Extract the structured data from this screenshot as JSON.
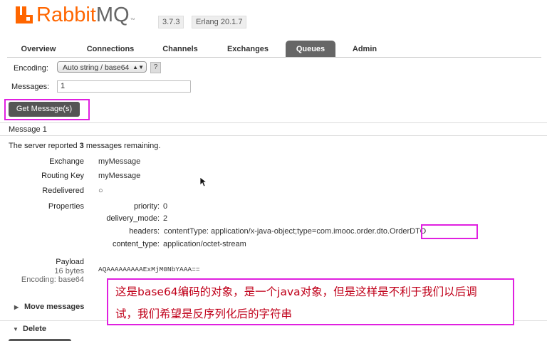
{
  "header": {
    "brand": "Rabbit",
    "brand_suffix": "MQ",
    "trademark": "™",
    "version": "3.7.3",
    "erlang": "Erlang 20.1.7"
  },
  "tabs": [
    {
      "label": "Overview"
    },
    {
      "label": "Connections"
    },
    {
      "label": "Channels"
    },
    {
      "label": "Exchanges"
    },
    {
      "label": "Queues",
      "active": true
    },
    {
      "label": "Admin"
    }
  ],
  "form": {
    "encoding_label": "Encoding:",
    "encoding_value": "Auto string / base64",
    "help": "?",
    "messages_label": "Messages:",
    "messages_value": "1",
    "get_button": "Get Message(s)"
  },
  "message": {
    "heading": "Message 1",
    "status_prefix": "The server reported ",
    "status_count": "3",
    "status_suffix": " messages remaining.",
    "fields": {
      "exchange_label": "Exchange",
      "exchange_value": "myMessage",
      "routing_key_label": "Routing Key",
      "routing_key_value": "myMessage",
      "redelivered_label": "Redelivered",
      "redelivered_value": "○",
      "properties_label": "Properties"
    },
    "properties": {
      "priority_label": "priority:",
      "priority_value": "0",
      "delivery_mode_label": "delivery_mode:",
      "delivery_mode_value": "2",
      "headers_label": "headers:",
      "headers_value": "contentType: application/x-java-object;type=com.imooc.order.dto.OrderDTO",
      "content_type_label": "content_type:",
      "content_type_value": "application/octet-stream"
    },
    "payload": {
      "label": "Payload",
      "size": "16 bytes",
      "encoding": "Encoding: base64",
      "value": "AQAAAAAAAAAExMjM0NbYAAA=="
    }
  },
  "sections": {
    "move": "Move messages",
    "delete": "Delete"
  },
  "annotation": {
    "line1": "这是base64编码的对象，是一个java对象，但是这样是不利于我们以后调",
    "line2": "试，我们希望是反序列化后的字符串"
  },
  "colors": {
    "brand": "#ff6600",
    "tab_active": "#666666",
    "highlight": "#e020e0",
    "annotation_text": "#c0001a"
  }
}
